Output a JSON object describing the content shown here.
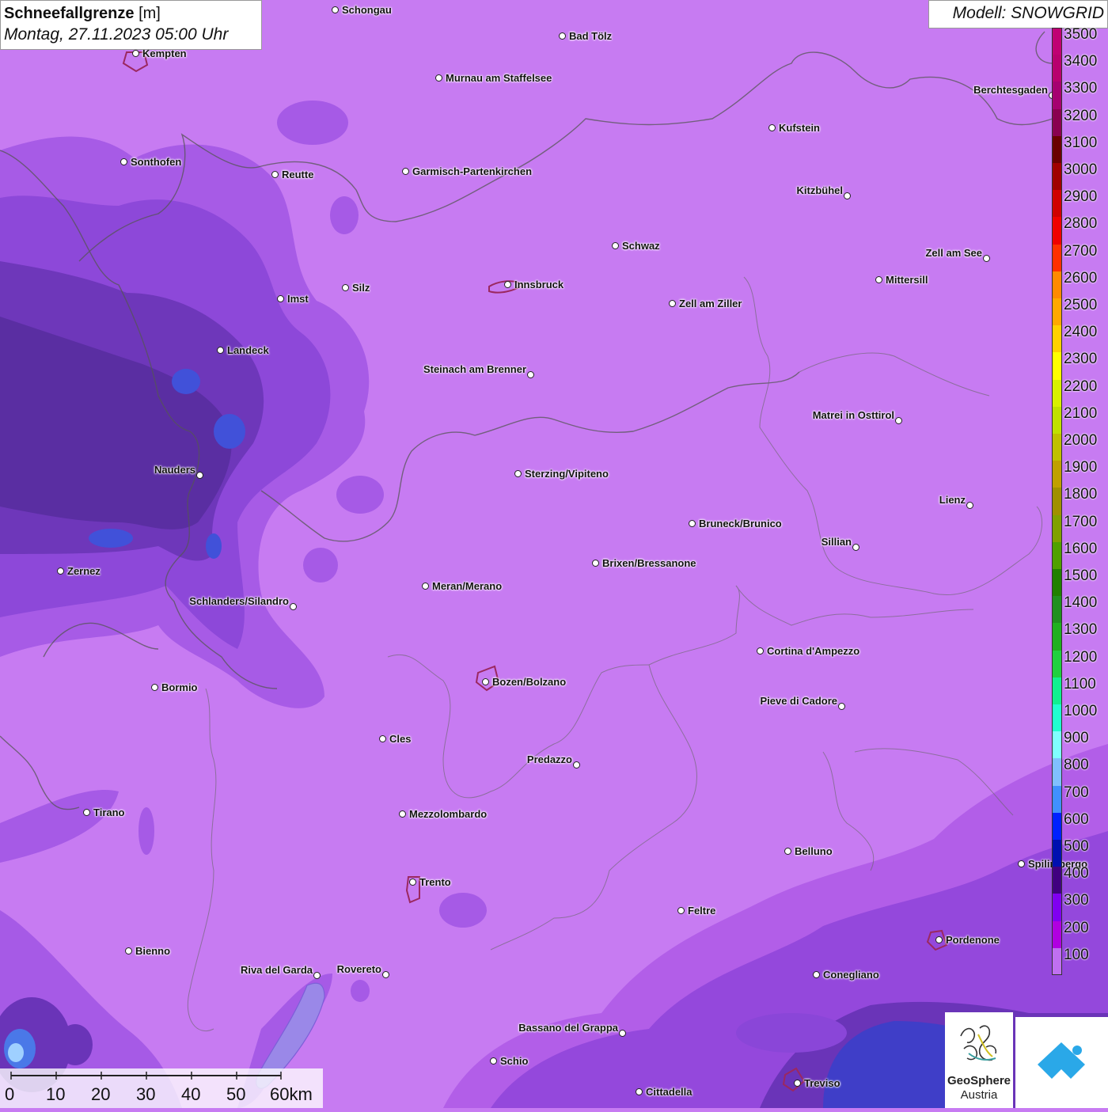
{
  "title": {
    "parameter": "Schneefallgrenze",
    "unit": "[m]",
    "datetime": "Montag, 27.11.2023 05:00 Uhr"
  },
  "model": "Modell: SNOWGRID",
  "legend": {
    "labels": [
      "3500",
      "3400",
      "3300",
      "3200",
      "3100",
      "3000",
      "2900",
      "2800",
      "2700",
      "2600",
      "2500",
      "2400",
      "2300",
      "2200",
      "2100",
      "2000",
      "1900",
      "1800",
      "1700",
      "1600",
      "1500",
      "1400",
      "1300",
      "1200",
      "1100",
      "1000",
      "900",
      "800",
      "700",
      "600",
      "500",
      "400",
      "300",
      "200",
      "100"
    ],
    "colors": [
      "#c00073",
      "#b8006e",
      "#a60070",
      "#8a0050",
      "#6a0000",
      "#a00000",
      "#d00000",
      "#f00000",
      "#ff3000",
      "#ff8a00",
      "#ffa800",
      "#ffd000",
      "#ffff00",
      "#d8f000",
      "#c0e000",
      "#c0c000",
      "#c0a000",
      "#a09000",
      "#80a000",
      "#50a000",
      "#208000",
      "#209020",
      "#20b020",
      "#20d040",
      "#10f090",
      "#20ffd0",
      "#80ffff",
      "#80c0ff",
      "#4090ff",
      "#0020ff",
      "#0010b0",
      "#400080",
      "#8000f0",
      "#b000e0",
      "#c070f0"
    ]
  },
  "scale_bar": {
    "labels": [
      "0",
      "10",
      "20",
      "30",
      "40",
      "50",
      "60km"
    ]
  },
  "cities": [
    {
      "name": "Schongau"
    },
    {
      "name": "Bad Tölz"
    },
    {
      "name": "Kempten"
    },
    {
      "name": "Murnau am Staffelsee"
    },
    {
      "name": "Berchtesgaden"
    },
    {
      "name": "Kufstein"
    },
    {
      "name": "Sonthofen"
    },
    {
      "name": "Reutte"
    },
    {
      "name": "Garmisch-Partenkirchen"
    },
    {
      "name": "Kitzbühel"
    },
    {
      "name": "Schwaz"
    },
    {
      "name": "Zell am See"
    },
    {
      "name": "Mittersill"
    },
    {
      "name": "Innsbruck"
    },
    {
      "name": "Imst"
    },
    {
      "name": "Silz"
    },
    {
      "name": "Zell am Ziller"
    },
    {
      "name": "Landeck"
    },
    {
      "name": "Steinach am Brenner"
    },
    {
      "name": "Matrei in Osttirol"
    },
    {
      "name": "Nauders"
    },
    {
      "name": "Sterzing/Vipiteno"
    },
    {
      "name": "Lienz"
    },
    {
      "name": "Bruneck/Brunico"
    },
    {
      "name": "Sillian"
    },
    {
      "name": "Zernez"
    },
    {
      "name": "Brixen/Bressanone"
    },
    {
      "name": "Meran/Merano"
    },
    {
      "name": "Schlanders/Silandro"
    },
    {
      "name": "Cortina d'Ampezzo"
    },
    {
      "name": "Bozen/Bolzano"
    },
    {
      "name": "Bormio"
    },
    {
      "name": "Pieve di Cadore"
    },
    {
      "name": "Cles"
    },
    {
      "name": "Predazzo"
    },
    {
      "name": "Tirano"
    },
    {
      "name": "Mezzolombardo"
    },
    {
      "name": "Belluno"
    },
    {
      "name": "Spilimbergo"
    },
    {
      "name": "Trento"
    },
    {
      "name": "Feltre"
    },
    {
      "name": "Pordenone"
    },
    {
      "name": "Bienno"
    },
    {
      "name": "Riva del Garda"
    },
    {
      "name": "Rovereto"
    },
    {
      "name": "Conegliano"
    },
    {
      "name": "Bassano del Grappa"
    },
    {
      "name": "Schio"
    },
    {
      "name": "Treviso"
    },
    {
      "name": "Cittadella"
    }
  ],
  "logos": {
    "geosphere_line1": "GeoSphere",
    "geosphere_line2": "Austria"
  }
}
